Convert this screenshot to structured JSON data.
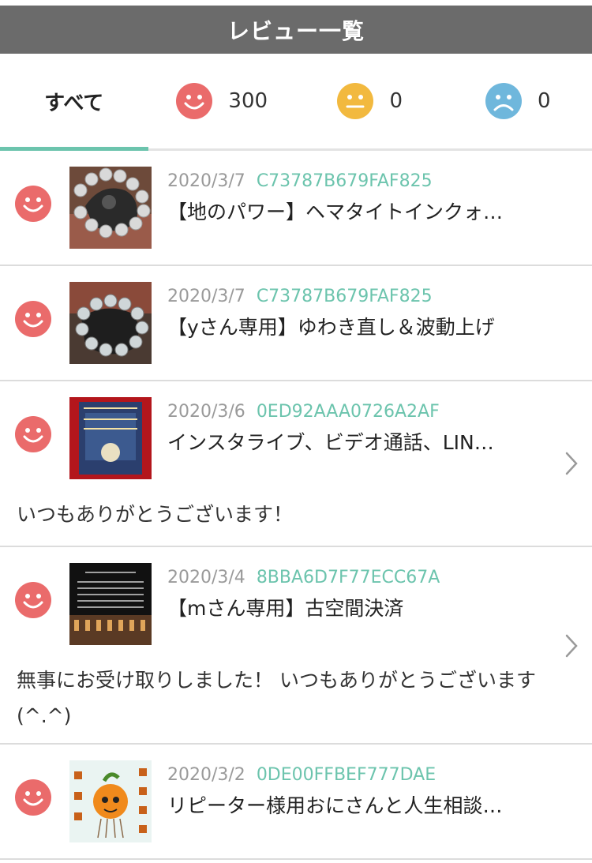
{
  "header": {
    "title": "レビュー一覧"
  },
  "tabs": {
    "all_label": "すべて",
    "good_count": "300",
    "neutral_count": "0",
    "bad_count": "0"
  },
  "colors": {
    "good": "#ea6b6b",
    "neutral": "#f2b93f",
    "bad": "#6fb7dc",
    "accent": "#6cc4ad"
  },
  "reviews": [
    {
      "date": "2020/3/7",
      "code": "C73787B679FAF825",
      "title": "【地のパワー】ヘマタイトインクォ…",
      "comment": "",
      "rating_icon": "smile-icon",
      "has_chevron": false
    },
    {
      "date": "2020/3/7",
      "code": "C73787B679FAF825",
      "title": "【yさん専用】ゆわき直し＆波動上げ",
      "comment": "",
      "rating_icon": "smile-icon",
      "has_chevron": false
    },
    {
      "date": "2020/3/6",
      "code": "0ED92AAA0726A2AF",
      "title": "インスタライブ、ビデオ通話、LIN…",
      "comment": "いつもありがとうございます！",
      "rating_icon": "smile-icon",
      "has_chevron": true
    },
    {
      "date": "2020/3/4",
      "code": "8BBA6D7F77ECC67A",
      "title": "【mさん専用】古空間決済",
      "comment": "無事にお受け取りしました！ いつもありがとうございます(^.^)",
      "rating_icon": "smile-icon",
      "has_chevron": true
    },
    {
      "date": "2020/3/2",
      "code": "0DE00FFBEF777DAE",
      "title": "リピーター様用おにさんと人生相談…",
      "comment": "",
      "rating_icon": "smile-icon",
      "has_chevron": false
    }
  ]
}
